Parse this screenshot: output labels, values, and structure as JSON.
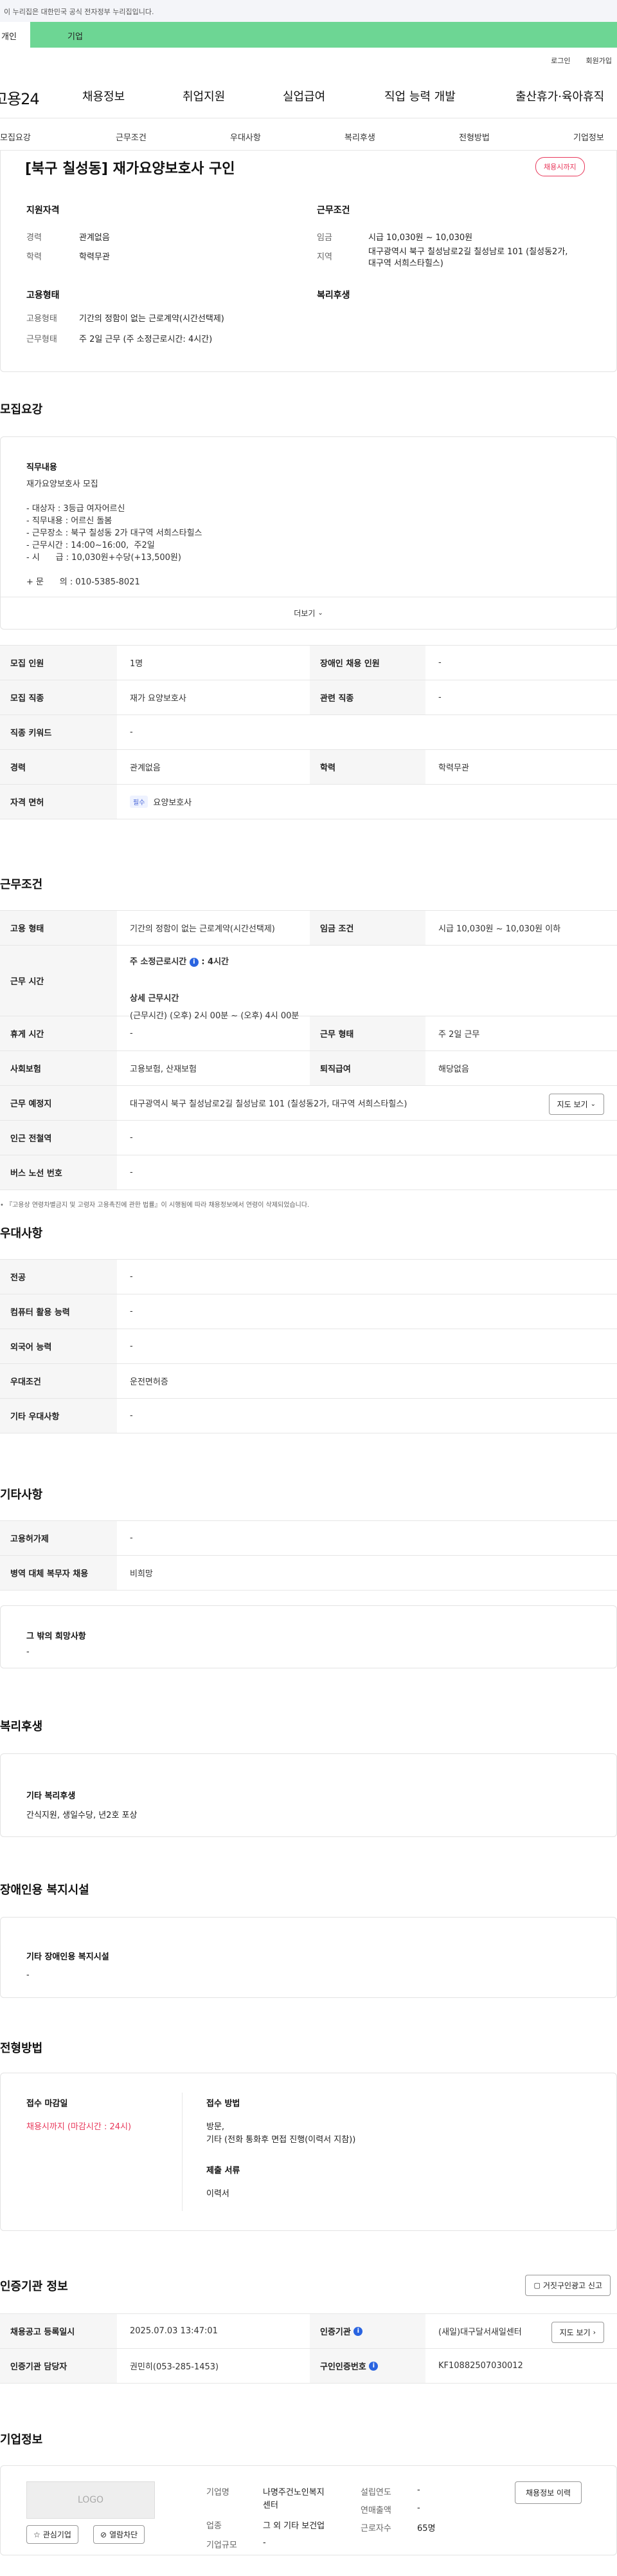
{
  "gov_notice": "이 누리집은 대한민국 공식 전자정부 누리집입니다.",
  "top_tabs": [
    "개인",
    "기업"
  ],
  "util": [
    "로그인",
    "회원가입"
  ],
  "logo": "고용24",
  "gnb": [
    "채용정보",
    "취업지원",
    "실업급여",
    "직업 능력 개발",
    "출산휴가·육아휴직"
  ],
  "subnav": [
    "모집요강",
    "근무조건",
    "우대사항",
    "복리후생",
    "전형방법",
    "기업정보"
  ],
  "job": {
    "title": "[북구 칠성동] 재가요양보호사 구인",
    "status_badge": "채용시까지",
    "qual_title": "지원자격",
    "career_label": "경력",
    "career": "관계없음",
    "edu_label": "학력",
    "edu": "학력무관",
    "cond_title": "근무조건",
    "wage_label": "임금",
    "wage": "시급 10,030원 ~ 10,030원",
    "region_label": "지역",
    "region_l1": "대구광역시 북구 칠성남로2길 칠성남로 101 (칠성동2가,",
    "region_l2": "대구역 서희스타힐스)",
    "emp_title": "고용형태",
    "emp_label": "고용형태",
    "emp": "기간의 정함이 없는 근로계약(시간선택제)",
    "work_label": "근무형태",
    "work": "주 2일 근무 (주 소정근로시간: 4시간)",
    "welfare_title": "복리후생"
  },
  "recruit": {
    "title": "모집요강",
    "duty_title": "직무내용",
    "duty_lines": [
      "재가요양보호사 모집",
      "",
      "- 대상자 : 3등급 여자어르신",
      "- 직무내용 : 어르신 돌봄",
      "- 근무장소 : 북구 칠성동 2가 대구역 서희스타힐스",
      "- 근무시간 : 14:00~16:00,  주2일",
      "- 시      급 : 10,030원+수당(+13,500원)",
      "",
      "+ 문      의 : 010-5385-8021"
    ],
    "more": "더보기",
    "rows": [
      {
        "h1": "모집 인원",
        "v1": "1명",
        "h2": "장애인 채용 인원",
        "v2": "-"
      },
      {
        "h1": "모집 직종",
        "v1": "재가 요양보호사",
        "h2": "관련 직종",
        "v2": "-"
      },
      {
        "h1": "직종 키워드",
        "v1": "-"
      },
      {
        "h1": "경력",
        "v1": "관계없음",
        "h2": "학력",
        "v2": "학력무관"
      },
      {
        "h1": "자격 면허",
        "tag": "필수",
        "v1": "요양보호사"
      }
    ]
  },
  "conditions": {
    "title": "근무조건",
    "emp_h": "고용 형태",
    "emp_v": "기간의 정함이 없는 근로계약(시간선택제)",
    "wage_h": "임금 조건",
    "wage_v": "시급 10,030원 ~ 10,030원 이하",
    "time_h": "근무 시간",
    "time_main": "주 소정근로시간",
    "time_main_val": ": 4시간",
    "time_detail_h": "상세 근무시간",
    "time_detail": "(근무시간) (오후) 2시 00분 ~ (오후) 4시 00분",
    "holiday_h": "휴게 시간",
    "holiday_v": "-",
    "worktype_h": "근무 형태",
    "worktype_v": "주 2일 근무",
    "insure_h": "사회보험",
    "insure_v": "고용보험, 산재보험",
    "retire_h": "퇴직급여",
    "retire_v": "해당없음",
    "place_h": "근무 예정지",
    "place_v": "대구광역시 북구 칠성남로2길 칠성남로 101 (칠성동2가, 대구역 서희스타힐스)",
    "map_btn": "지도 보기",
    "subway_h": "인근 전철역",
    "subway_v": "-",
    "bus_h": "버스 노선 번호",
    "bus_v": "-",
    "notice": "『고용상 연령차별금지 및 고령자 고용촉진에 관한 법률』이 시행됨에 따라 채용정보에서 연령이 삭제되었습니다."
  },
  "pref": {
    "title": "우대사항",
    "rows": [
      {
        "h": "전공",
        "v": "-"
      },
      {
        "h": "컴퓨터 활용 능력",
        "v": "-"
      },
      {
        "h": "외국어 능력",
        "v": "-"
      },
      {
        "h": "우대조건",
        "v": "운전면허증"
      },
      {
        "h": "기타 우대사항",
        "v": "-"
      }
    ]
  },
  "etc": {
    "title": "기타사항",
    "rows": [
      {
        "h": "고용허가제",
        "v": "-"
      },
      {
        "h": "병역 대체 복무자 채용",
        "v": "비희망"
      }
    ],
    "other_h": "그 밖의 희망사항",
    "other_v": "-"
  },
  "welfare": {
    "title": "복리후생",
    "box_h": "기타 복리후생",
    "box_v": "간식지원, 생일수당, 년2호 포상"
  },
  "disabled": {
    "title": "장애인용 복지시설",
    "box_h": "기타 장애인용 복지시설",
    "box_v": "-"
  },
  "selection": {
    "title": "전형방법",
    "deadline_h": "접수 마감일",
    "deadline_v": "채용시까지 (마감시간 : 24시)",
    "method_h": "접수 방법",
    "method_l1": "방문,",
    "method_l2": "기타 (전화 통화후 면접 진행(이력서 지참))",
    "docs_h": "제출 서류",
    "docs_v": "이력서"
  },
  "agency": {
    "title": "인증기관 정보",
    "report_btn": "거짓구인광고 신고",
    "r1h1": "채용공고 등록일시",
    "r1v1": "2025.07.03 13:47:01",
    "r1h2": "인증기관",
    "r1v2": "(새일)대구달서새일센터",
    "map_btn": "지도 보기",
    "r2h1": "인증기관 담당자",
    "r2v1": "권민히(053-285-1453)",
    "r2h2": "구인인증번호",
    "r2v2": "KF10882507030012"
  },
  "company": {
    "title": "기업정보",
    "logo": "LOGO",
    "fav_btn": "관심기업",
    "block_btn": "열람차단",
    "name_h": "기업명",
    "name_l1": "나명주건노인복지",
    "name_l2": "센터",
    "biz_h": "업종",
    "biz_v": "그 외 기타 보건업",
    "size_h": "기업규모",
    "size_v": "-",
    "year_h": "설립연도",
    "year_v": "-",
    "sales_h": "연매출액",
    "sales_v": "-",
    "emp_h": "근로자수",
    "emp_v": "65명",
    "hire_btn": "채용정보 이력"
  }
}
